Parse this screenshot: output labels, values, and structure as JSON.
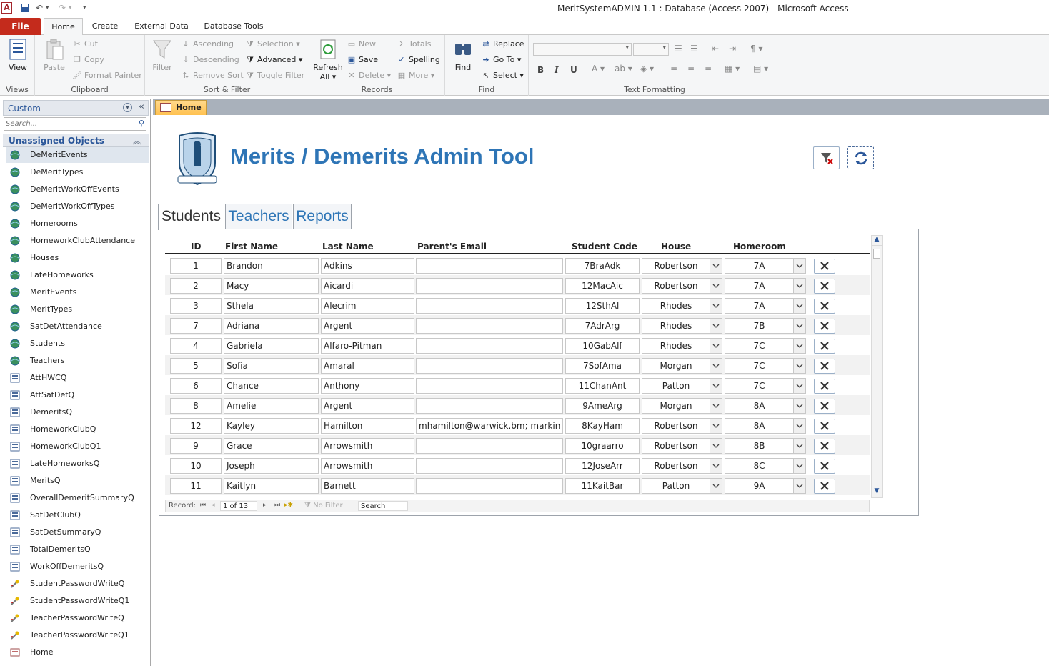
{
  "window": {
    "title": "MeritSystemADMIN 1.1  : Database (Access 2007)  -  Microsoft Access"
  },
  "ribbon": {
    "tabs": [
      "File",
      "Home",
      "Create",
      "External Data",
      "Database Tools"
    ],
    "active_tab": "Home",
    "views": {
      "view": "View",
      "label": "Views"
    },
    "clipboard": {
      "paste": "Paste",
      "cut": "Cut",
      "copy": "Copy",
      "format_painter": "Format Painter",
      "label": "Clipboard"
    },
    "sort_filter": {
      "filter": "Filter",
      "ascending": "Ascending",
      "descending": "Descending",
      "remove_sort": "Remove Sort",
      "selection": "Selection",
      "advanced": "Advanced",
      "toggle_filter": "Toggle Filter",
      "label": "Sort & Filter"
    },
    "records": {
      "refresh": "Refresh",
      "refresh_all": "All",
      "new": "New",
      "save": "Save",
      "delete": "Delete",
      "totals": "Totals",
      "spelling": "Spelling",
      "more": "More",
      "label": "Records"
    },
    "find": {
      "find": "Find",
      "replace": "Replace",
      "goto": "Go To",
      "select": "Select",
      "label": "Find"
    },
    "text_formatting": {
      "label": "Text Formatting",
      "bold": "B",
      "italic": "I",
      "underline": "U"
    }
  },
  "nav": {
    "title": "Custom",
    "search_placeholder": "Search...",
    "group": "Unassigned Objects",
    "items": [
      {
        "label": "DeMeritEvents",
        "type": "table"
      },
      {
        "label": "DeMeritTypes",
        "type": "table"
      },
      {
        "label": "DeMeritWorkOffEvents",
        "type": "table"
      },
      {
        "label": "DeMeritWorkOffTypes",
        "type": "table"
      },
      {
        "label": "Homerooms",
        "type": "table"
      },
      {
        "label": "HomeworkClubAttendance",
        "type": "table"
      },
      {
        "label": "Houses",
        "type": "table"
      },
      {
        "label": "LateHomeworks",
        "type": "table"
      },
      {
        "label": "MeritEvents",
        "type": "table"
      },
      {
        "label": "MeritTypes",
        "type": "table"
      },
      {
        "label": "SatDetAttendance",
        "type": "table"
      },
      {
        "label": "Students",
        "type": "table"
      },
      {
        "label": "Teachers",
        "type": "table"
      },
      {
        "label": "AttHWCQ",
        "type": "query"
      },
      {
        "label": "AttSatDetQ",
        "type": "query"
      },
      {
        "label": "DemeritsQ",
        "type": "query"
      },
      {
        "label": "HomeworkClubQ",
        "type": "query"
      },
      {
        "label": "HomeworkClubQ1",
        "type": "query"
      },
      {
        "label": "LateHomeworksQ",
        "type": "query"
      },
      {
        "label": "MeritsQ",
        "type": "query"
      },
      {
        "label": "OverallDemeritSummaryQ",
        "type": "query"
      },
      {
        "label": "SatDetClubQ",
        "type": "query"
      },
      {
        "label": "SatDetSummaryQ",
        "type": "query"
      },
      {
        "label": "TotalDemeritsQ",
        "type": "query"
      },
      {
        "label": "WorkOffDemeritsQ",
        "type": "query"
      },
      {
        "label": "StudentPasswordWriteQ",
        "type": "update"
      },
      {
        "label": "StudentPasswordWriteQ1",
        "type": "update"
      },
      {
        "label": "TeacherPasswordWriteQ",
        "type": "update"
      },
      {
        "label": "TeacherPasswordWriteQ1",
        "type": "update"
      },
      {
        "label": "Home",
        "type": "form"
      }
    ]
  },
  "doc": {
    "tab": "Home",
    "title": "Merits / Demerits Admin Tool",
    "form_tabs": [
      "Students",
      "Teachers",
      "Reports"
    ],
    "columns": [
      "ID",
      "First Name",
      "Last Name",
      "Parent's Email",
      "Student Code",
      "House",
      "Homeroom"
    ],
    "rows": [
      {
        "id": "1",
        "first": "Brandon",
        "last": "Adkins",
        "email": "",
        "code": "7BraAdk",
        "house": "Robertson",
        "homeroom": "7A"
      },
      {
        "id": "2",
        "first": "Macy",
        "last": "Aicardi",
        "email": "",
        "code": "12MacAic",
        "house": "Robertson",
        "homeroom": "7A"
      },
      {
        "id": "3",
        "first": "Sthela",
        "last": "Alecrim",
        "email": "",
        "code": "12SthAl",
        "house": "Rhodes",
        "homeroom": "7A"
      },
      {
        "id": "7",
        "first": "Adriana",
        "last": "Argent",
        "email": "",
        "code": "7AdrArg",
        "house": "Rhodes",
        "homeroom": "7B"
      },
      {
        "id": "4",
        "first": "Gabriela",
        "last": "Alfaro-Pitman",
        "email": "",
        "code": "10GabAlf",
        "house": "Rhodes",
        "homeroom": "7C"
      },
      {
        "id": "5",
        "first": "Sofia",
        "last": "Amaral",
        "email": "",
        "code": "7SofAma",
        "house": "Morgan",
        "homeroom": "7C"
      },
      {
        "id": "6",
        "first": "Chance",
        "last": "Anthony",
        "email": "",
        "code": "11ChanAnt",
        "house": "Patton",
        "homeroom": "7C"
      },
      {
        "id": "8",
        "first": "Amelie",
        "last": "Argent",
        "email": "",
        "code": "9AmeArg",
        "house": "Morgan",
        "homeroom": "8A"
      },
      {
        "id": "12",
        "first": "Kayley",
        "last": "Hamilton",
        "email": "mhamilton@warwick.bm; markin",
        "code": "8KayHam",
        "house": "Robertson",
        "homeroom": "8A"
      },
      {
        "id": "9",
        "first": "Grace",
        "last": "Arrowsmith",
        "email": "",
        "code": "10graarro",
        "house": "Robertson",
        "homeroom": "8B"
      },
      {
        "id": "10",
        "first": "Joseph",
        "last": "Arrowsmith",
        "email": "",
        "code": "12JoseArr",
        "house": "Robertson",
        "homeroom": "8C"
      },
      {
        "id": "11",
        "first": "Kaitlyn",
        "last": "Barnett",
        "email": "",
        "code": "11KaitBar",
        "house": "Patton",
        "homeroom": "9A"
      }
    ],
    "navbar": {
      "record_label": "Record:",
      "record_value": "1 of 13",
      "filter": "No Filter",
      "search": "Search"
    }
  }
}
